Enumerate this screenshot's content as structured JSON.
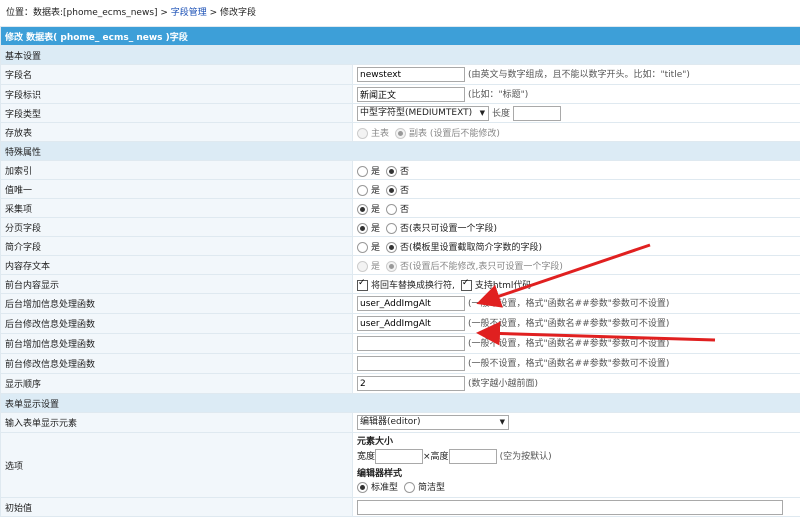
{
  "breadcrumb": {
    "prefix": "位置：数据表:[phome_ecms_news] > ",
    "link": "字段管理",
    "suffix": " > 修改字段"
  },
  "title": "修改 数据表( phome_ ecms_ news )字段",
  "sections": {
    "basic": "基本设置",
    "special": "特殊属性",
    "form": "表单显示设置"
  },
  "rows": {
    "field_name": {
      "label": "字段名",
      "value": "newstext",
      "hint": "(由英文与数字组成，且不能以数字开头。比如：\"title\")"
    },
    "field_label": {
      "label": "字段标识",
      "value": "新闻正文",
      "hint": "(比如：\"标题\")"
    },
    "field_type": {
      "label": "字段类型",
      "value": "中型字符型(MEDIUMTEXT)",
      "length_label": "长度"
    },
    "storage": {
      "label": "存放表",
      "opt1": "主表",
      "opt2": "副表",
      "hint": "(设置后不能修改)"
    },
    "index": {
      "label": "加索引",
      "yes": "是",
      "no": "否"
    },
    "unique": {
      "label": "值唯一",
      "yes": "是",
      "no": "否"
    },
    "collect": {
      "label": "采集项",
      "yes": "是",
      "no": "否"
    },
    "paging": {
      "label": "分页字段",
      "yes": "是",
      "no": "否(表只可设置一个字段)"
    },
    "intro": {
      "label": "简介字段",
      "yes": "是",
      "no": "否(模板里设置截取简介字数的字段)"
    },
    "content_store": {
      "label": "内容存文本",
      "yes": "是",
      "no": "否(设置后不能修改,表只可设置一个字段)"
    },
    "front_display": {
      "label": "前台内容显示",
      "opt1": "将回车替换成换行符,",
      "opt2": "支持html代码"
    },
    "back_add_fn": {
      "label": "后台增加信息处理函数",
      "value": "user_AddImgAlt",
      "hint": "(一般不设置，格式\"函数名##参数\"参数可不设置)"
    },
    "back_edit_fn": {
      "label": "后台修改信息处理函数",
      "value": "user_AddImgAlt",
      "hint": "(一般不设置，格式\"函数名##参数\"参数可不设置)"
    },
    "front_add_fn": {
      "label": "前台增加信息处理函数",
      "value": "",
      "hint": "(一般不设置，格式\"函数名##参数\"参数可不设置)"
    },
    "front_edit_fn": {
      "label": "前台修改信息处理函数",
      "value": "",
      "hint": "(一般不设置，格式\"函数名##参数\"参数可不设置)"
    },
    "order": {
      "label": "显示顺序",
      "value": "2",
      "hint": "(数字越小越前面)"
    },
    "input_element": {
      "label": "输入表单显示元素",
      "value": "编辑器(editor)"
    },
    "options": {
      "label": "选项",
      "size_title": "元素大小",
      "width_label": "宽度",
      "height_label": "×高度",
      "size_hint": "(空为按默认)",
      "editor_style_title": "编辑器样式",
      "style1": "标准型",
      "style2": "简洁型"
    },
    "initial": {
      "label": "初始值"
    }
  },
  "colors": {
    "title_bg": "#3d9fd8",
    "section_bg": "#dcebf5",
    "arrow": "#e02020"
  }
}
